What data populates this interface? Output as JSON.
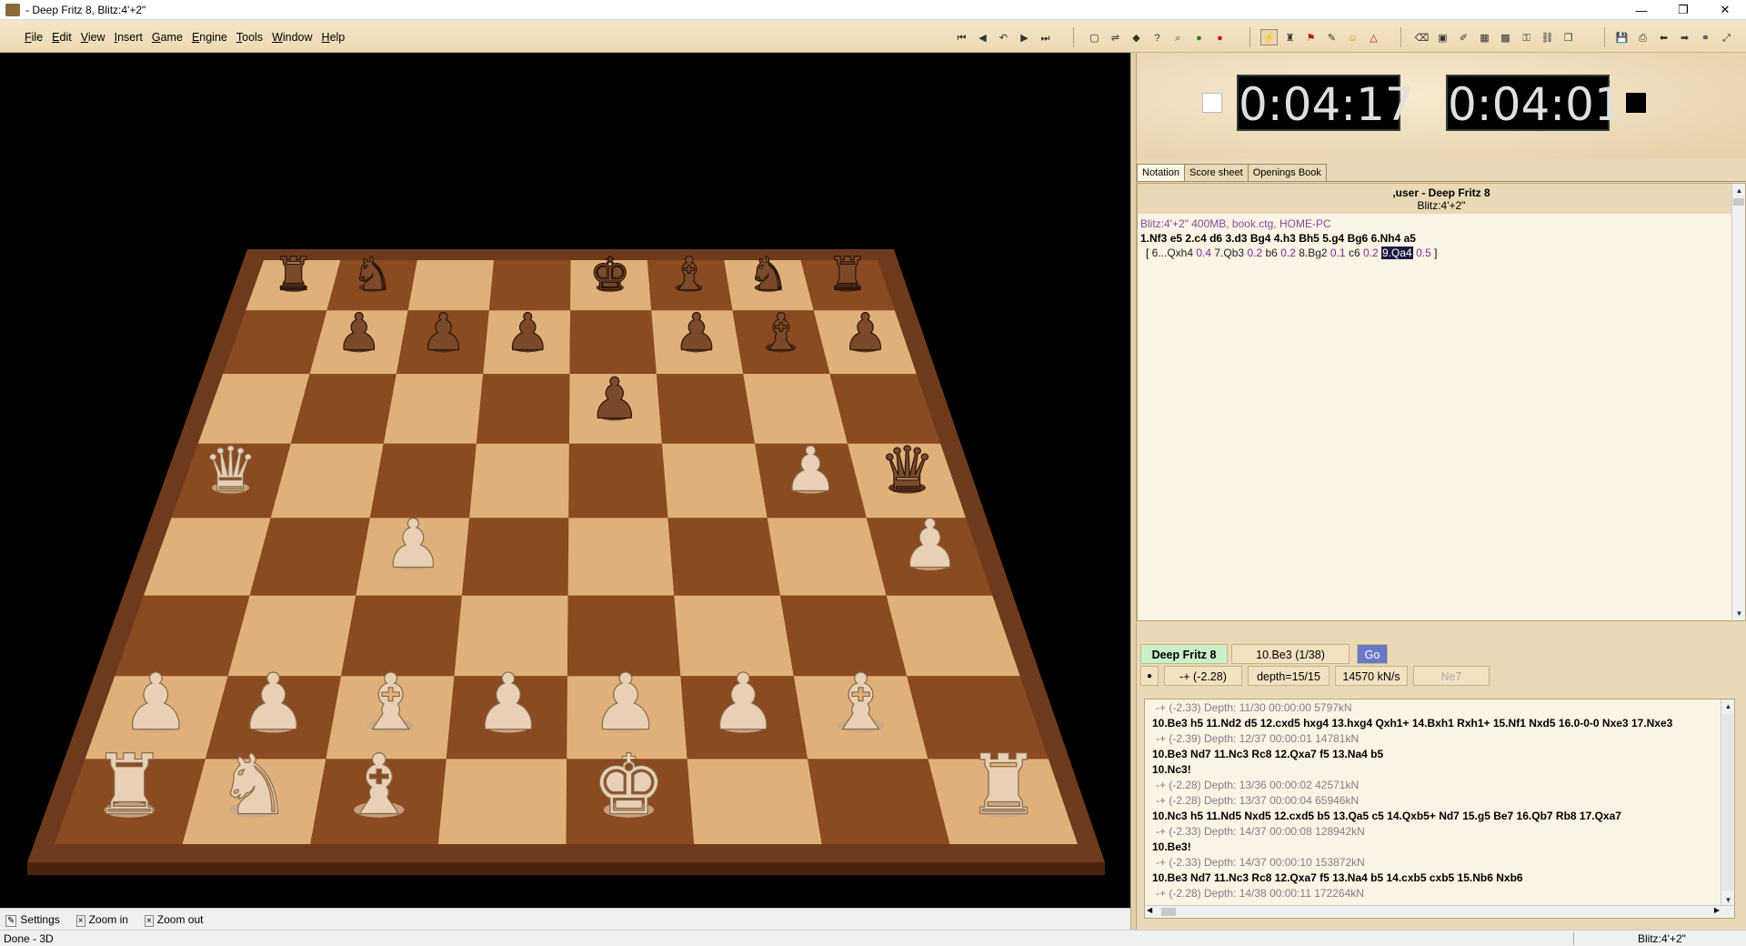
{
  "window": {
    "title": "- Deep Fritz 8, Blitz:4'+2\""
  },
  "window_controls": {
    "minimize": "—",
    "restore": "❐",
    "close": "✕"
  },
  "menu": [
    "File",
    "Edit",
    "View",
    "Insert",
    "Game",
    "Engine",
    "Tools",
    "Window",
    "Help"
  ],
  "toolbar_icons": [
    "first-move",
    "prev-move",
    "undo",
    "next-move",
    "last-move",
    "new-game",
    "flip-board",
    "3d-board",
    "analysis",
    "search",
    "accept",
    "stop",
    "attack",
    "game-info",
    "flag",
    "pen",
    "smiley",
    "triangle",
    "eraser",
    "save-position",
    "database",
    "grid",
    "board-icon",
    "key",
    "link",
    "database-window",
    "save",
    "print",
    "back",
    "forward",
    "binoculars",
    "expand"
  ],
  "clocks": {
    "white": "0:04:17",
    "black": "0:04:01"
  },
  "tabs": [
    "Notation",
    "Score sheet",
    "Openings Book"
  ],
  "notation": {
    "players": ",user - Deep Fritz 8",
    "event": "Blitz:4'+2\"",
    "info": "Blitz:4'+2\"  400MB, book.ctg, HOME-PC",
    "moves": [
      "1.Nf3",
      "e5",
      "2.c4",
      "d6",
      "3.d3",
      "Bg4",
      "4.h3",
      "Bh5",
      "5.g4",
      "Bg6",
      "6.Nh4",
      "a5"
    ],
    "variation_open": "[",
    "variation": [
      {
        "move": "6...Qxh4",
        "eval": "0.4"
      },
      {
        "move": "7.Qb3",
        "eval": "0.2"
      },
      {
        "move": "b6",
        "eval": "0.2"
      },
      {
        "move": "8.Bg2",
        "eval": "0.1"
      },
      {
        "move": "c6",
        "eval": "0.2"
      },
      {
        "move": "9.Qa4",
        "eval": "0.5",
        "current": true
      }
    ],
    "variation_close": "]"
  },
  "engine": {
    "name": "Deep Fritz 8",
    "current_move": "10.Be3 (1/38)",
    "go_label": "Go",
    "eval": "-+  (-2.28)",
    "depth": "depth=15/15",
    "speed": "14570 kN/s",
    "hint": "Ne7"
  },
  "analysis": [
    {
      "meta": "-+  (-2.33)   Depth: 11/30   00:00:00   5797kN",
      "pv": "10.Be3 h5 11.Nd2 d5 12.cxd5 hxg4 13.hxg4 Qxh1+ 14.Bxh1 Rxh1+ 15.Nf1 Nxd5 16.0-0-0 Nxe3 17.Nxe3"
    },
    {
      "meta": "-+  (-2.39)   Depth: 12/37   00:00:01   14781kN",
      "pv": "10.Be3 Nd7 11.Nc3 Rc8 12.Qxa7 f5 13.Na4 b5"
    },
    {
      "meta": "",
      "pv": "10.Nc3!"
    },
    {
      "meta": "-+  (-2.28)   Depth: 13/36   00:00:02   42571kN",
      "pv": ""
    },
    {
      "meta": "-+  (-2.28)   Depth: 13/37   00:00:04   65946kN",
      "pv": "10.Nc3 h5 11.Nd5 Nxd5 12.cxd5 b5 13.Qa5 c5 14.Qxb5+ Nd7 15.g5 Be7 16.Qb7 Rb8 17.Qxa7"
    },
    {
      "meta": "-+  (-2.33)   Depth: 14/37   00:00:08   128942kN",
      "pv": ""
    },
    {
      "meta": "",
      "pv": "10.Be3!"
    },
    {
      "meta": "-+  (-2.33)   Depth: 14/37   00:00:10   153872kN",
      "pv": "10.Be3 Nd7 11.Nc3 Rc8 12.Qxa7 f5 13.Na4 b5 14.cxb5 cxb5 15.Nb6 Nxb6"
    },
    {
      "meta": "-+  (-2.28)   Depth: 14/38   00:00:11   172264kN",
      "pv": ""
    }
  ],
  "board_bar": [
    "Settings",
    "Zoom in",
    "Zoom out"
  ],
  "status": {
    "left": "Done - 3D",
    "right": "Blitz:4'+2\""
  },
  "board": {
    "light_square": "#e0b07a",
    "dark_square": "#8a4a22",
    "frame": "#6e3a1c",
    "pieces_light": "#e8d0b4",
    "pieces_dark": "#7a4a2a",
    "position": [
      [
        "r",
        "n",
        ".",
        ".",
        "k",
        "b",
        "n",
        "r"
      ],
      [
        ".",
        "p",
        "p",
        "p",
        ".",
        "p",
        "b",
        "p"
      ],
      [
        ".",
        ".",
        ".",
        ".",
        "p",
        ".",
        ".",
        "."
      ],
      [
        "Q",
        ".",
        ".",
        ".",
        ".",
        ".",
        "P",
        "q"
      ],
      [
        ".",
        ".",
        "P",
        ".",
        ".",
        ".",
        ".",
        "P"
      ],
      [
        ".",
        ".",
        ".",
        ".",
        ".",
        ".",
        ".",
        " "
      ],
      [
        "P",
        "P",
        "B",
        "P",
        "P",
        "P",
        "B",
        "."
      ],
      [
        "R",
        "N",
        "B",
        ".",
        "K",
        ".",
        ".",
        "R"
      ]
    ]
  }
}
